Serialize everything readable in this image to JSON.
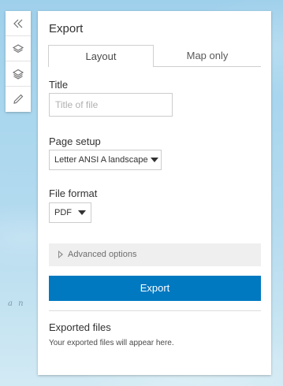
{
  "map": {
    "label_fragment": "a n"
  },
  "toolbar": {
    "items": [
      {
        "icon": "double-chevron-left-icon"
      },
      {
        "icon": "layers-icon"
      },
      {
        "icon": "basemap-layers-icon"
      },
      {
        "icon": "pencil-icon"
      }
    ]
  },
  "panel": {
    "title": "Export",
    "tabs": [
      {
        "label": "Layout",
        "active": true
      },
      {
        "label": "Map only",
        "active": false
      }
    ],
    "title_field": {
      "label": "Title",
      "value": "",
      "placeholder": "Title of file"
    },
    "page_setup": {
      "label": "Page setup",
      "selected": "Letter ANSI A landscape"
    },
    "file_format": {
      "label": "File format",
      "selected": "PDF"
    },
    "advanced_label": "Advanced options",
    "export_button": "Export",
    "exported_files": {
      "title": "Exported files",
      "note": "Your exported files will appear here."
    }
  },
  "colors": {
    "accent": "#0079c1",
    "advanced_bg": "#efefef",
    "text": "#323232"
  }
}
